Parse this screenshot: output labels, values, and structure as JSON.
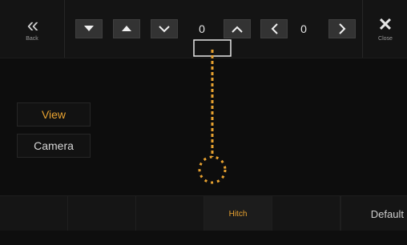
{
  "header": {
    "back_label": "Back",
    "back_glyph": "«",
    "close_label": "Close",
    "close_glyph": "✕",
    "vertical_value": "0",
    "horizontal_value": "0",
    "icons": {
      "down_filled": "triangle-down-icon",
      "up_filled": "triangle-up-icon",
      "down_chevron": "chevron-down-icon",
      "up_chevron": "chevron-up-icon",
      "left_chevron": "chevron-left-icon",
      "right_chevron": "chevron-right-icon"
    }
  },
  "side_menu": {
    "view_label": "View",
    "camera_label": "Camera"
  },
  "tabs": {
    "items": [
      "",
      "",
      "",
      "Hitch",
      ""
    ],
    "default_label": "Default"
  },
  "colors": {
    "accent": "#e8a230",
    "background": "#0d0d0d",
    "button": "#333333"
  }
}
